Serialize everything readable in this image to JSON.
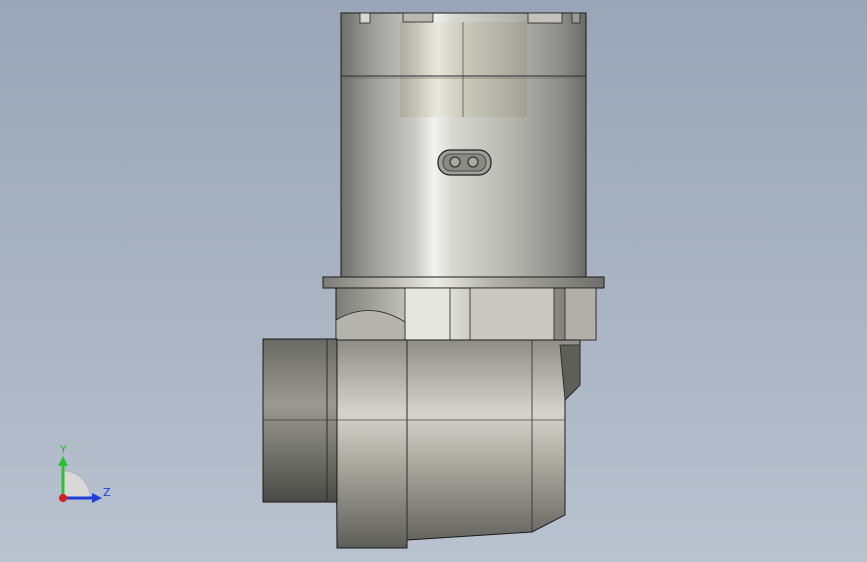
{
  "viewport": {
    "background_top": "#9aa6b8",
    "background_bottom": "#b9c2cf"
  },
  "triad": {
    "y_label": "Y",
    "z_label": "Z",
    "y_color": "#2fbf2f",
    "z_color": "#1f3fd6",
    "x_color": "#d62020"
  },
  "model": {
    "icon": "gearbox-motor-assembly"
  }
}
